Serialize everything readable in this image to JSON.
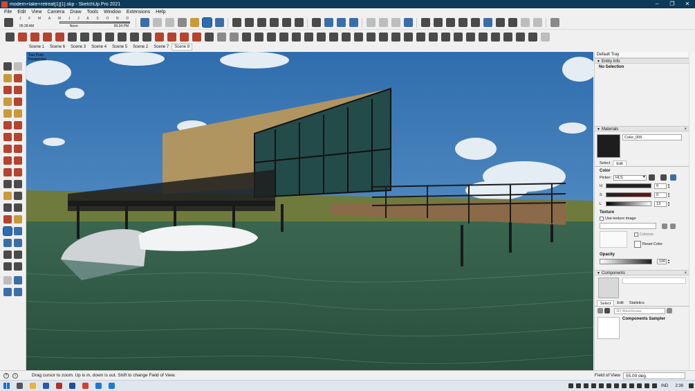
{
  "window": {
    "title": "modern+lake+retreat[1][1].skp - SketchUp Pro 2021",
    "controls": [
      "–",
      "❐",
      "✕"
    ]
  },
  "menu": [
    "File",
    "Edit",
    "View",
    "Camera",
    "Draw",
    "Tools",
    "Window",
    "Extensions",
    "Help"
  ],
  "shadows": {
    "months": [
      "J",
      "F",
      "M",
      "A",
      "M",
      "J",
      "J",
      "A",
      "S",
      "O",
      "N",
      "D"
    ],
    "time_start": "05:28 AM",
    "time_mid": "Noon",
    "time_end": "06:34 PM"
  },
  "scenes": [
    "Scene 1",
    "Scene 6",
    "Scene 3",
    "Scene 4",
    "Scene 5",
    "Scene 2",
    "Scene 7",
    "Scene 8"
  ],
  "active_scene": "Scene 8",
  "viewport": {
    "label_line1": "Two Point",
    "label_line2": "Perspective",
    "sky_color": "#3778b8",
    "water_color": "#2f5a45"
  },
  "tray": {
    "title": "Default Tray",
    "entity_info": {
      "heading": "Entity Info",
      "value": "No Selection"
    },
    "materials": {
      "heading": "Materials",
      "material_name": "Color_006",
      "swatch_color": "#1d1d1d",
      "tab_select": "Select",
      "tab_edit": "Edit",
      "color_label": "Color",
      "picker_label": "Picker:",
      "picker_value": "HLS",
      "h_label": "H",
      "h_value": "0",
      "s_label": "S",
      "s_value": "0",
      "l_label": "L",
      "l_value": "13",
      "texture_label": "Texture",
      "use_texture": "Use texture image",
      "colorize": "Colorize",
      "reset_color": "Reset Color",
      "opacity_label": "Opacity",
      "opacity_value": "100"
    },
    "components": {
      "heading": "Components",
      "tab_select": "Select",
      "tab_edit": "Edit",
      "tab_statistics": "Statistics",
      "search_placeholder": "3D Warehouse",
      "sampler_name": "Components Sampler"
    }
  },
  "status": {
    "message": "Drag cursor to zoom.  Up is in, down is out. Shift to change Field of View.",
    "fov_label": "Field of View",
    "fov_value": "55.00 deg."
  },
  "taskbar": {
    "lang": "IND",
    "time": "2:39"
  }
}
